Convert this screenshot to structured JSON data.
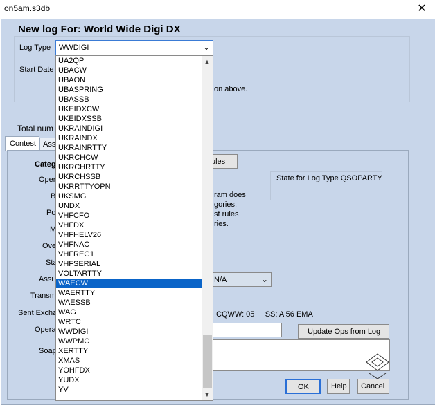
{
  "window": {
    "title": "on5am.s3db",
    "close_glyph": "✕"
  },
  "dialog": {
    "heading": "New log For: World Wide Digi DX",
    "log_type_label": "Log Type",
    "log_type_value": "WWDIGI",
    "start_date_label": "Start Date",
    "partial_text_above": "on above.",
    "total_label": "Total num",
    "tabs": [
      "Contest",
      "Ass"
    ],
    "category_label": "Categ",
    "left_labels": [
      "Oper",
      "B",
      "Po",
      "M",
      "Ove",
      "Sta",
      "Assi",
      "Transm",
      "Sent Excha",
      "Opera",
      "Soap"
    ],
    "rules_button": "ules",
    "state_label": "State for Log Type QSOPARTY",
    "info_lines": [
      "ram does",
      "gories.",
      "st rules",
      "ries."
    ],
    "na_combo_value": "N/A",
    "exchange_hint": "CQWW: 05     SS: A 56 EMA",
    "update_ops_button": "Update Ops from Log",
    "ok_button": "OK",
    "help_button": "Help",
    "cancel_button": "Cancel"
  },
  "dropdown": {
    "selected": "WAECW",
    "items": [
      "UA2QP",
      "UBACW",
      "UBAON",
      "UBASPRING",
      "UBASSB",
      "UKEIDXCW",
      "UKEIDXSSB",
      "UKRAINDIGI",
      "UKRAINDX",
      "UKRAINRTTY",
      "UKRCHCW",
      "UKRCHRTTY",
      "UKRCHSSB",
      "UKRRTTYOPN",
      "UKSMG",
      "UNDX",
      "VHFCFO",
      "VHFDX",
      "VHFHELV26",
      "VHFNAC",
      "VHFREG1",
      "VHFSERIAL",
      "VOLTARTTY",
      "WAECW",
      "WAERTTY",
      "WAESSB",
      "WAG",
      "WRTC",
      "WWDIGI",
      "WWPMC",
      "XERTTY",
      "XMAS",
      "YOHFDX",
      "YUDX",
      "YV"
    ]
  },
  "icons": {
    "dropdown_arrow": "chevron-down-icon",
    "scroll_up": "chevron-up-icon",
    "scroll_down": "chevron-down-icon"
  }
}
